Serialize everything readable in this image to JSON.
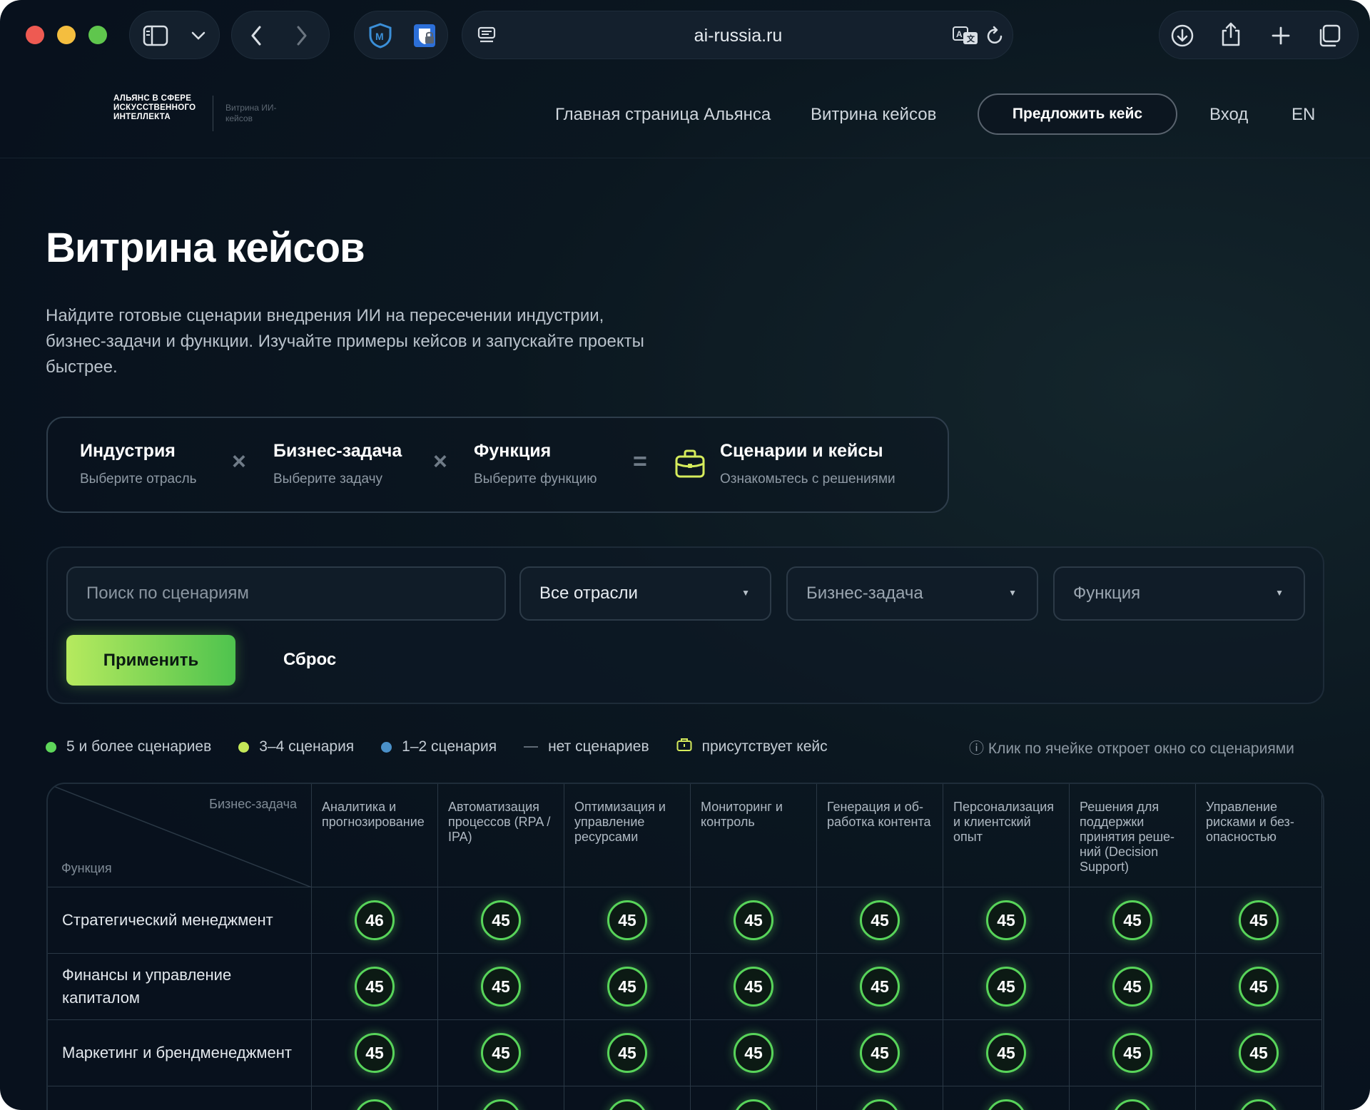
{
  "browser": {
    "url": "ai-russia.ru"
  },
  "header": {
    "logo_text": "АЛЬЯНС В СФЕРЕ ИСКУССТВЕННОГО ИНТЕЛЛЕКТА",
    "logo_sub": "Витрина ИИ-кейсов",
    "nav_home": "Главная страница Альянса",
    "nav_cases": "Витрина кейсов",
    "propose_button": "Предложить кейс",
    "login": "Вход",
    "lang": "EN"
  },
  "hero": {
    "title": "Витрина кейсов",
    "description": "Найдите готовые сценарии внедрения ИИ на пересечении индустрии, бизнес-задачи и функции. Изучайте примеры кейсов и запускайте проекты быстрее."
  },
  "formula": {
    "industry_title": "Индустрия",
    "industry_sub": "Выберите отрасль",
    "task_title": "Бизнес-задача",
    "task_sub": "Выберите задачу",
    "function_title": "Функция",
    "function_sub": "Выберите функцию",
    "result_title": "Сценарии и кейсы",
    "result_sub": "Ознакомьтесь с решениями",
    "op_times": "×",
    "op_equals": "="
  },
  "filters": {
    "search_placeholder": "Поиск по сценариям",
    "industry_value": "Все отрасли",
    "task_value": "Бизнес-задача",
    "function_value": "Функция",
    "apply_label": "Применить",
    "reset_label": "Сброс"
  },
  "legend": {
    "five_plus": "5 и более сценариев",
    "three_four": "3–4 сценария",
    "one_two": "1–2 сценария",
    "none": "нет сценариев",
    "has_case": "присутствует кейс",
    "hint": "ⓘ Клик по ячейке откроет окно со сценариями",
    "colors": {
      "five_plus": "#5ed65a",
      "three_four": "#c4e858",
      "one_two": "#4a90c8"
    }
  },
  "matrix": {
    "corner_task": "Бизнес-задача",
    "corner_function": "Функция",
    "columns": [
      "Аналитика и прогнозиро­вание",
      "Автоматизация процессов (RPA / IPA)",
      "Оптимизация и управление ресурсами",
      "Мониторинг и контроль",
      "Генерация и об­работка кон­тента",
      "Персонализа­ция и клиент­ский опыт",
      "Решения для поддержки принятия реше­ний (Decision Support)",
      "Управление рисками и без­опасностью"
    ],
    "rows": [
      {
        "label": "Стратегический менеджмент",
        "values": [
          "46",
          "45",
          "45",
          "45",
          "45",
          "45",
          "45",
          "45"
        ]
      },
      {
        "label": "Финансы и управление капиталом",
        "values": [
          "45",
          "45",
          "45",
          "45",
          "45",
          "45",
          "45",
          "45"
        ]
      },
      {
        "label": "Маркетинг и бренд­менеджмент",
        "values": [
          "45",
          "45",
          "45",
          "45",
          "45",
          "45",
          "45",
          "45"
        ]
      }
    ]
  }
}
